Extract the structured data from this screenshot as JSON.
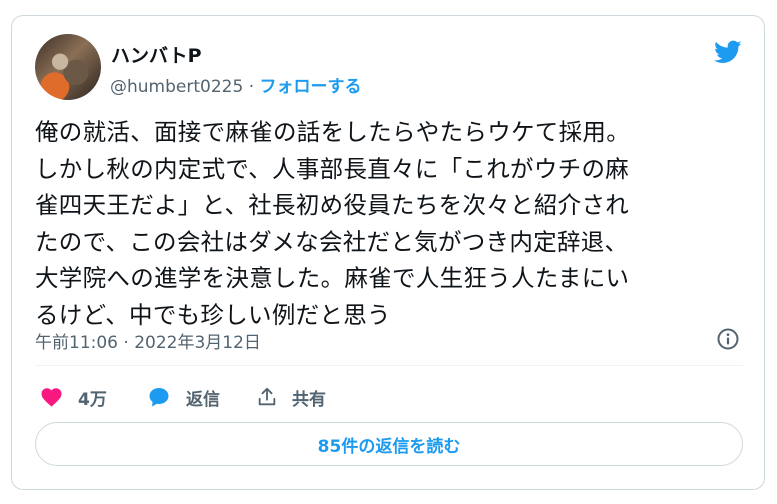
{
  "tweet": {
    "author_name": "ハンバトP",
    "handle": "@humbert0225",
    "separator": "·",
    "follow_label": "フォローする",
    "text_lines": [
      "俺の就活、面接で麻雀の話をしたらやたらウケて採用。",
      "しかし秋の内定式で、人事部長直々に「これがウチの麻",
      "雀四天王だよ」と、社長初め役員たちを次々と紹介され",
      "たので、この会社はダメな会社だと気がつき内定辞退、",
      "大学院への進学を決意した。麻雀で人生狂う人たまにい",
      "るけど、中でも珍しい例だと思う"
    ],
    "time": "午前11:06",
    "date": "2022年3月12日"
  },
  "actions": {
    "like_count": "4万",
    "reply_label": "返信",
    "share_label": "共有"
  },
  "replies_button": "85件の返信を読む",
  "colors": {
    "accent": "#1d9bf0",
    "like": "#f91880",
    "secondary_text": "#536471",
    "border": "#cfd9de"
  },
  "icons": [
    "twitter-bird-icon",
    "info-icon",
    "heart-icon",
    "reply-bubble-icon",
    "share-icon"
  ]
}
